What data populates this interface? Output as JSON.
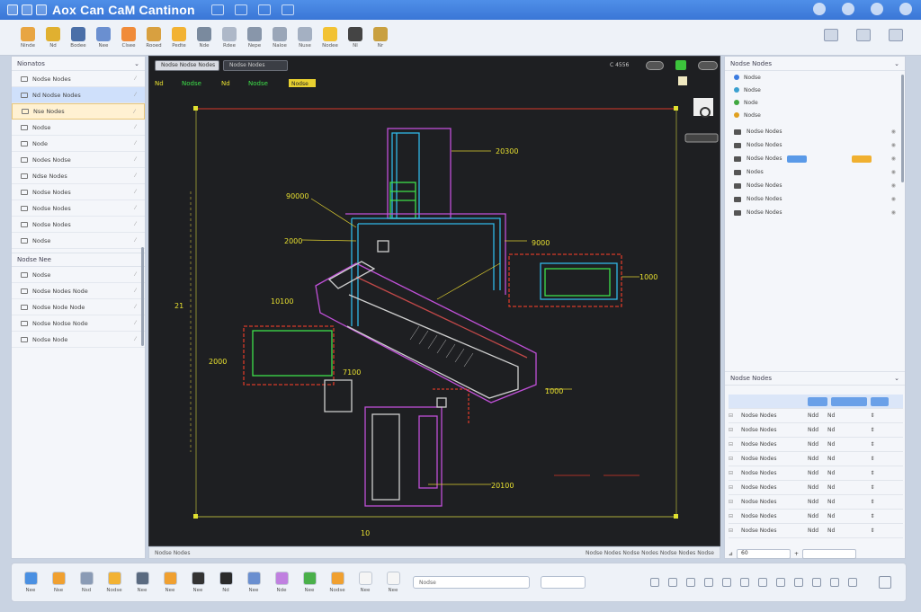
{
  "app": {
    "title": "Aox Can CaM Cantinon"
  },
  "ribbon": {
    "items": [
      {
        "label": "Ninde",
        "icon": "pencil-icon",
        "color": "#e8a542"
      },
      {
        "label": "Nd",
        "icon": "hardhat-icon",
        "color": "#e0b030"
      },
      {
        "label": "Bodee",
        "icon": "monitor-icon",
        "color": "#4a6fa8"
      },
      {
        "label": "Nee",
        "icon": "box-icon",
        "color": "#6a8fd0"
      },
      {
        "label": "Clsee",
        "icon": "doc-icon",
        "color": "#f08b3a"
      },
      {
        "label": "Rooed",
        "icon": "folder-icon",
        "color": "#d8a040"
      },
      {
        "label": "Pedte",
        "icon": "house-icon",
        "color": "#f2b233"
      },
      {
        "label": "Nde",
        "icon": "layers-icon",
        "color": "#7a8a9e"
      },
      {
        "label": "Rdee",
        "icon": "window-icon",
        "color": "#aeb8c8"
      },
      {
        "label": "Nepe",
        "icon": "frame-icon",
        "color": "#8896aa"
      },
      {
        "label": "Naloe",
        "icon": "picture-icon",
        "color": "#9aa6b8"
      },
      {
        "label": "Nuse",
        "icon": "cube-icon",
        "color": "#a4b0c2"
      },
      {
        "label": "Nodee",
        "icon": "sun-icon",
        "color": "#f2c233"
      },
      {
        "label": "Nl",
        "icon": "grid-icon",
        "color": "#444"
      },
      {
        "label": "Nr",
        "icon": "ruler-icon",
        "color": "#c9a040"
      }
    ]
  },
  "left_panel": {
    "header": "Nionatos",
    "rows": [
      {
        "label": "Nodse Nodes"
      },
      {
        "label": "Nd Nodse Nodes"
      },
      {
        "label": "Nse Nodes"
      },
      {
        "label": "Nodse"
      },
      {
        "label": "Node"
      },
      {
        "label": "Nodes Nodse"
      },
      {
        "label": "Ndse Nodes"
      },
      {
        "label": "Nodse Nodes"
      },
      {
        "label": "Nodse Nodes"
      },
      {
        "label": "Nodse Nodes"
      },
      {
        "label": "Nodse"
      }
    ],
    "section2_header": "Nodse Nee",
    "section2_rows": [
      {
        "label": "Nodse"
      },
      {
        "label": "Nodse Nodes Node"
      },
      {
        "label": "Nodse Node Node"
      },
      {
        "label": "Nodse Nodse Node"
      },
      {
        "label": "Nodse Node"
      }
    ]
  },
  "canvas": {
    "tabs": [
      {
        "label": "Nodse Nodse Nodes"
      },
      {
        "label": "Nodse Nodes"
      }
    ],
    "readout": "C 4556",
    "toolbar_labels": [
      "Nd",
      "Nodse",
      "Nd",
      "Nodse",
      "Nodse"
    ],
    "dimensions": [
      {
        "text": "20300"
      },
      {
        "text": "9000"
      },
      {
        "text": "2000"
      },
      {
        "text": "90000"
      },
      {
        "text": "10100"
      },
      {
        "text": "2000"
      },
      {
        "text": "1000"
      },
      {
        "text": "10"
      },
      {
        "text": "1000"
      },
      {
        "text": "20100"
      },
      {
        "text": "7100"
      },
      {
        "text": "21"
      }
    ],
    "footer_left": "Nodse Nodes",
    "footer_right": "Nodse Nodes Nodse Nodes Nodse Nodes Nodse"
  },
  "right_panel": {
    "header": "Nodse Nodes",
    "layers": [
      {
        "label": "Nodse",
        "color": "#3a7be0"
      },
      {
        "label": "Nodse",
        "color": "#3aa0d0"
      },
      {
        "label": "Node",
        "color": "#40a840"
      },
      {
        "label": "Nodse",
        "color": "#e0a020"
      }
    ],
    "tree_rows": [
      {
        "label": "Nodse Nodes"
      },
      {
        "label": "Nodse Nodes"
      },
      {
        "label": "Nodse Nodes"
      },
      {
        "label": "Nodes"
      },
      {
        "label": "Nodse Nodes"
      },
      {
        "label": "Nodse Nodes"
      },
      {
        "label": "Nodse Nodes"
      }
    ],
    "properties_header": "Nodse Nodes",
    "properties": [
      {
        "name": "Nodse Nodes",
        "v1": "Ndd",
        "v2": "Nd"
      },
      {
        "name": "Nodse Nodes",
        "v1": "Ndd",
        "v2": "Nd"
      },
      {
        "name": "Nodse Nodes",
        "v1": "Ndd",
        "v2": "Nd"
      },
      {
        "name": "Nodse Nodes",
        "v1": "Ndd",
        "v2": "Nd"
      },
      {
        "name": "Nodse Nodes",
        "v1": "Ndd",
        "v2": "Nd"
      },
      {
        "name": "Nodse Nodes",
        "v1": "Ndd",
        "v2": "Nd"
      },
      {
        "name": "Nodse Nodes",
        "v1": "Ndd",
        "v2": "Nd"
      },
      {
        "name": "Nodse Nodes",
        "v1": "Ndd",
        "v2": "Nd"
      },
      {
        "name": "Nodse Nodes",
        "v1": "Ndd",
        "v2": "Nd"
      }
    ],
    "footer_value": "60"
  },
  "dock": {
    "items": [
      {
        "label": "Nee",
        "color": "#4a90e2"
      },
      {
        "label": "Nse",
        "color": "#f0a030"
      },
      {
        "label": "Nsd",
        "color": "#8a9bb5"
      },
      {
        "label": "Nodse",
        "color": "#f2b233"
      },
      {
        "label": "Nee",
        "color": "#5a6a80"
      },
      {
        "label": "Nee",
        "color": "#f0a030"
      },
      {
        "label": "Nee",
        "color": "#333"
      },
      {
        "label": "Nd",
        "color": "#2b2b2b"
      },
      {
        "label": "Nee",
        "color": "#6a8fd0"
      },
      {
        "label": "Nde",
        "color": "#c080e0"
      },
      {
        "label": "Nee",
        "color": "#4ab04a"
      },
      {
        "label": "Nodse",
        "color": "#f0a030"
      },
      {
        "label": "Nee",
        "color": "#f5f5f5"
      },
      {
        "label": "Nee",
        "color": "#f5f5f5"
      }
    ],
    "search_placeholder": "Nodse"
  }
}
